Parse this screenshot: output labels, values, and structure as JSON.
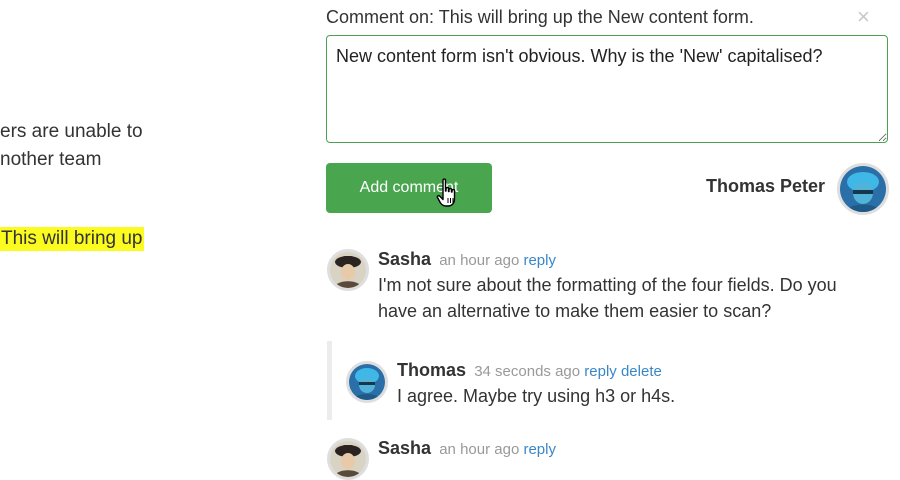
{
  "document": {
    "line1": "ers are unable to",
    "line2": "nother team",
    "highlight": "This will bring up"
  },
  "panel": {
    "comment_on": "Comment on: This will bring up the New content form.",
    "close_symbol": "×",
    "input_value": "New content form isn't obvious. Why is the 'New' capitalised?",
    "add_button_label": "Add comment",
    "current_user": "Thomas Peter",
    "accent_color": "#4aa54f",
    "highlight_color": "#fbfb1f"
  },
  "comments": [
    {
      "author": "Sasha",
      "time": "an hour ago",
      "reply": "reply",
      "text_line1": "I'm not sure about the formatting of the four fields. Do you",
      "text_line2": "have an alternative to make them easier to scan?"
    },
    {
      "author": "Thomas",
      "time": "34 seconds ago",
      "reply": "reply",
      "delete": "delete",
      "text": "I agree. Maybe try using h3 or h4s."
    },
    {
      "author": "Sasha",
      "time": "an hour ago",
      "reply": "reply"
    }
  ]
}
